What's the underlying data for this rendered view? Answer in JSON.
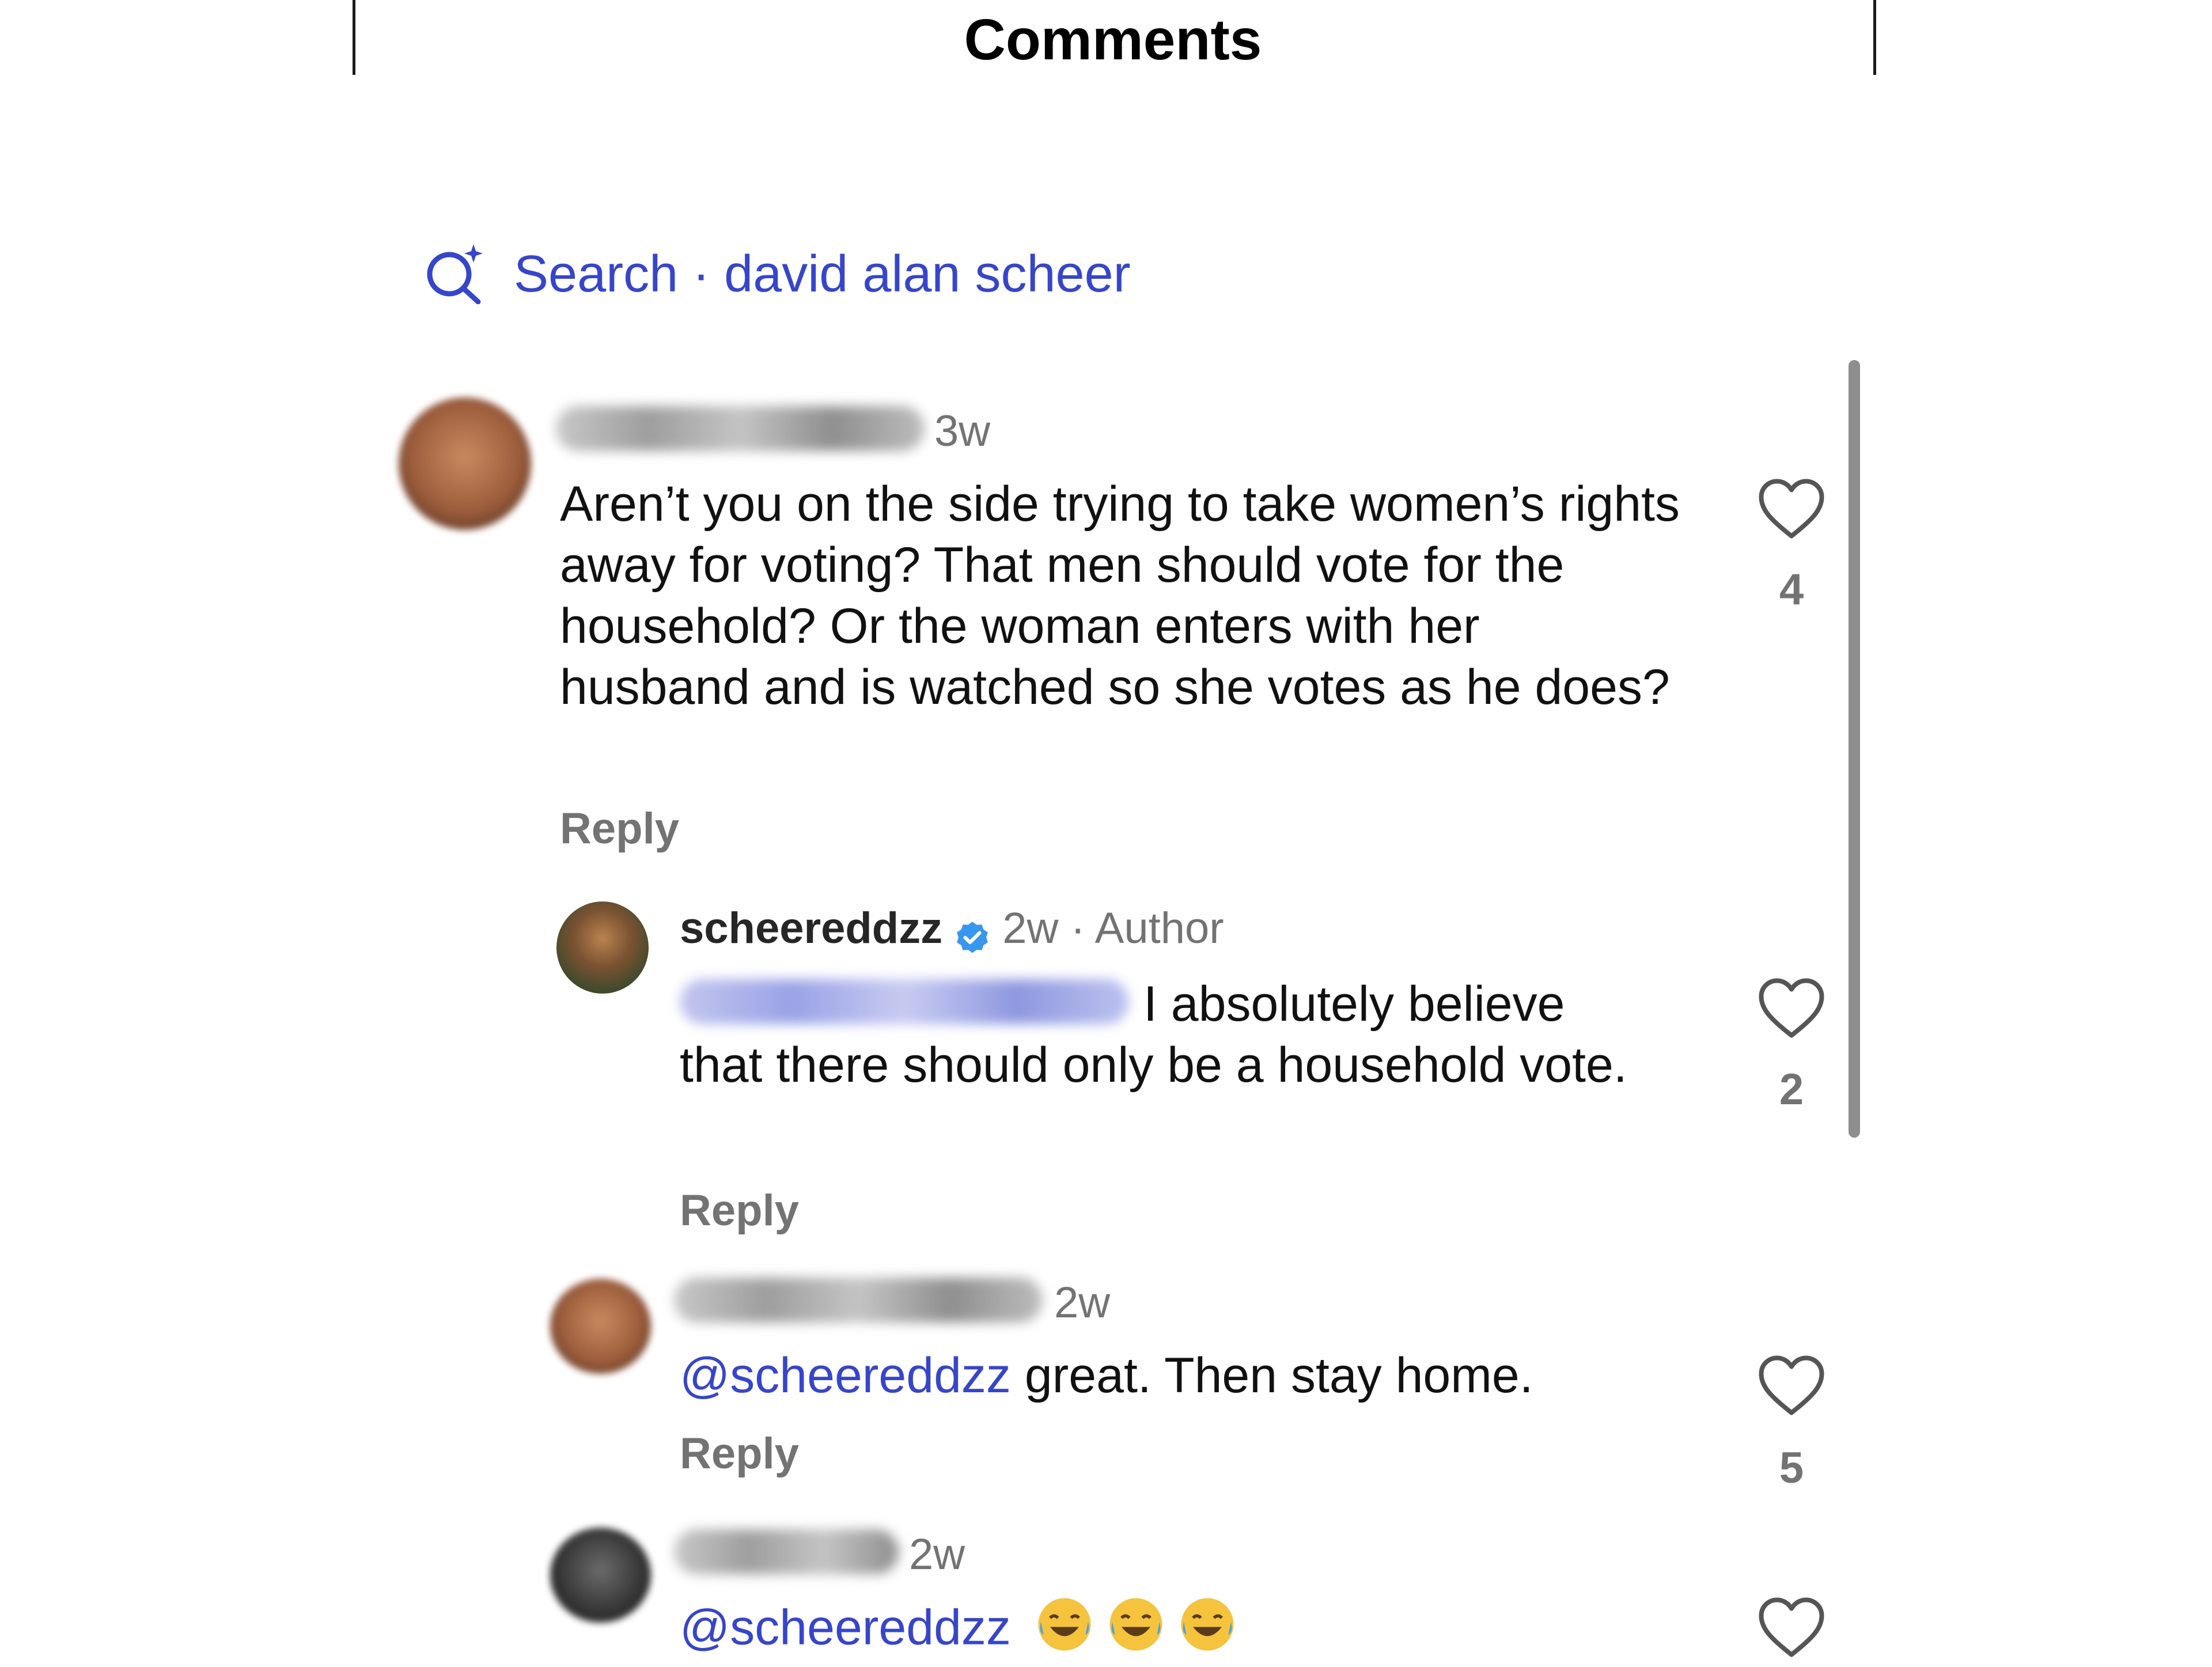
{
  "header": {
    "title": "Comments"
  },
  "search": {
    "label": "Search · david alan scheer"
  },
  "comments": [
    {
      "time": "3w",
      "text": "Aren’t you on the side trying to take women’s rights away for voting? That men should vote for the household? Or the woman enters with her husband and is watched so she votes as he does?",
      "reply_label": "Reply",
      "likes": "4"
    },
    {
      "username": "scheereddzz",
      "time_meta": "2w · Author",
      "text": "I absolutely believe that there should only be a household vote.",
      "reply_label": "Reply",
      "likes": "2"
    },
    {
      "time": "2w",
      "mention": "@scheereddzz",
      "text": " great. Then stay home.",
      "reply_label": "Reply",
      "likes": "5"
    },
    {
      "time": "2w",
      "mention": "@scheereddzz",
      "emoji": "😂😂😂"
    }
  ],
  "colors": {
    "link": "#3545d0",
    "verified": "#3797f0",
    "muted": "#737373"
  },
  "icons": [
    "sparkle-search-icon",
    "heart-icon",
    "verified-badge-icon"
  ]
}
